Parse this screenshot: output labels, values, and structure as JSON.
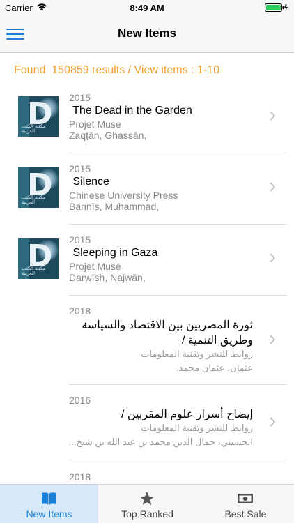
{
  "status": {
    "carrier": "Carrier",
    "time": "8:49 AM"
  },
  "nav": {
    "title": "New Items",
    "menu_icon": "hamburger-icon"
  },
  "summary": {
    "text": "Found  150859 results / View items : 1-10"
  },
  "items": [
    {
      "year": "2015",
      "title": " The Dead in the Garden",
      "publisher": "Projet Muse",
      "author": "Zaqṭān, Ghassān,",
      "cover_letter": "D",
      "cover_caption": "مكتبة الكتب العربية"
    },
    {
      "year": "2015",
      "title": " Silence",
      "publisher": "Chinese University Press",
      "author": "Bannīs, Muḥammad,",
      "cover_letter": "D",
      "cover_caption": "مكتبة الكتب العربية"
    },
    {
      "year": "2015",
      "title": " Sleeping in Gaza",
      "publisher": "Projet Muse",
      "author": "Darwīsh, Najwān,",
      "cover_letter": "D",
      "cover_caption": "مكتبة الكتب العربية"
    },
    {
      "year": "2018",
      "title": "ثورة المصريين بين الاقتصاد والسياسة وطريق التنمية /",
      "publisher": "روابط للنشر وتقنية المعلومات",
      "author": "عثمان، عثمان محمد."
    },
    {
      "year": "2016",
      "title": "إيضاح أسرار علوم المقربين /",
      "publisher": "روابط للنشر وتقنية المعلومات",
      "author": "الحسيني، جمال الدين محمد بن عبد الله بن شيخ..."
    },
    {
      "year": "2018"
    }
  ],
  "tabs": [
    {
      "label": "New Items",
      "icon": "book-icon",
      "active": true
    },
    {
      "label": "Top Ranked",
      "icon": "star-icon",
      "active": false
    },
    {
      "label": "Best Sale",
      "icon": "banknote-icon",
      "active": false
    }
  ],
  "colors": {
    "accent": "#1a7fd6",
    "summary": "#f0a030",
    "active_tab_bg": "#d7e8f8"
  }
}
